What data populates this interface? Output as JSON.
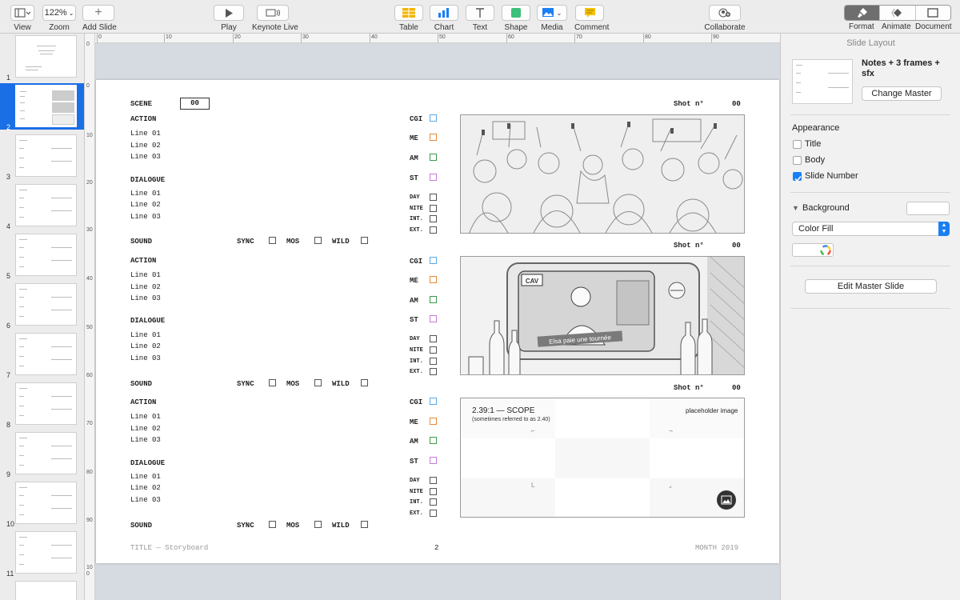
{
  "toolbar": {
    "view": "View",
    "zoom_value": "122%",
    "zoom": "Zoom",
    "add_slide": "Add Slide",
    "play": "Play",
    "keynote_live": "Keynote Live",
    "table": "Table",
    "chart": "Chart",
    "text": "Text",
    "shape": "Shape",
    "media": "Media",
    "comment": "Comment",
    "collaborate": "Collaborate",
    "format": "Format",
    "animate": "Animate",
    "document": "Document"
  },
  "navigator": {
    "slides": [
      "1",
      "2",
      "3",
      "4",
      "5",
      "6",
      "7",
      "8",
      "9",
      "10",
      "11"
    ],
    "selected": "2"
  },
  "ruler": {
    "horizontal": [
      "0",
      "10",
      "20",
      "30",
      "40",
      "50",
      "60",
      "70",
      "80",
      "90"
    ],
    "vertical": [
      "0",
      "10",
      "20",
      "30",
      "40",
      "50",
      "60",
      "70",
      "80",
      "90",
      "100"
    ]
  },
  "slide": {
    "scene_label": "SCENE",
    "scene_number": "00",
    "blocks": [
      {
        "action": "ACTION",
        "action_lines": [
          "Line 01",
          "Line 02",
          "Line 03"
        ],
        "dialogue": "DIALOGUE",
        "dialogue_lines": [
          "Line 01",
          "Line 02",
          "Line 03"
        ],
        "sound": "SOUND",
        "sync": "SYNC",
        "mos": "MOS",
        "wild": "WILD",
        "tags": [
          "CGI",
          "ME",
          "AM",
          "ST"
        ],
        "times": [
          "DAY",
          "NITE",
          "INT.",
          "EXT."
        ],
        "shot_label": "Shot n°",
        "shot_number": "00"
      },
      {
        "action": "ACTION",
        "action_lines": [
          "Line 01",
          "Line 02",
          "Line 03"
        ],
        "dialogue": "DIALOGUE",
        "dialogue_lines": [
          "Line 01",
          "Line 02",
          "Line 03"
        ],
        "sound": "SOUND",
        "sync": "SYNC",
        "mos": "MOS",
        "wild": "WILD",
        "tags": [
          "CGI",
          "ME",
          "AM",
          "ST"
        ],
        "times": [
          "DAY",
          "NITE",
          "INT.",
          "EXT."
        ],
        "shot_label": "Shot n°",
        "shot_number": "00"
      },
      {
        "action": "ACTION",
        "action_lines": [
          "Line 01",
          "Line 02",
          "Line 03"
        ],
        "dialogue": "DIALOGUE",
        "dialogue_lines": [
          "Line 01",
          "Line 02",
          "Line 03"
        ],
        "sound": "SOUND",
        "sync": "SYNC",
        "mos": "MOS",
        "wild": "WILD",
        "tags": [
          "CGI",
          "ME",
          "AM",
          "ST"
        ],
        "times": [
          "DAY",
          "NITE",
          "INT.",
          "EXT."
        ],
        "shot_label": "Shot n°",
        "shot_number": "00"
      }
    ],
    "tag_colors": [
      "#5aa9e6",
      "#e58a3a",
      "#3d9a4a",
      "#c77ad8"
    ],
    "frame2_caption": "Elsa paie une tournée",
    "frame2_logo": "CAV",
    "placeholder_title": "2.39:1 — SCOPE",
    "placeholder_sub": "(sometimes referred to as 2.40)",
    "placeholder_label": "placeholder image",
    "footer_left": "TITLE — Storyboard",
    "footer_page": "2",
    "footer_right": "MONTH 2019"
  },
  "inspector": {
    "title": "Slide Layout",
    "master_name": "Notes + 3 frames + sfx",
    "change_master": "Change Master",
    "appearance": "Appearance",
    "title_opt": "Title",
    "body_opt": "Body",
    "slide_number_opt": "Slide Number",
    "background": "Background",
    "fill_type": "Color Fill",
    "edit_master": "Edit Master Slide",
    "accent": "#1a7ff5"
  }
}
